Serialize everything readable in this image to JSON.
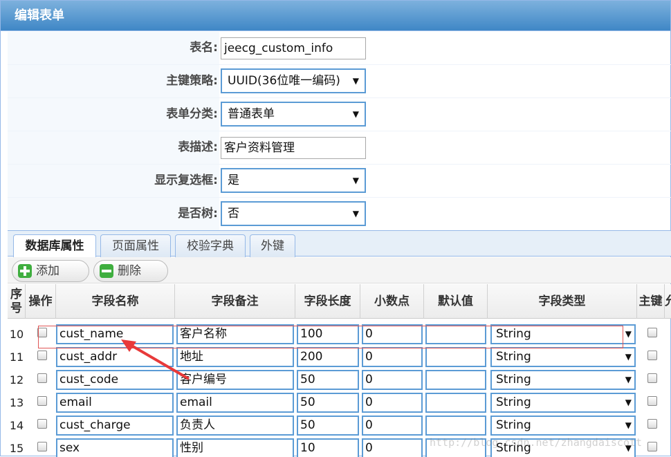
{
  "panel": {
    "title": "编辑表单"
  },
  "form": {
    "table_name": {
      "label": "表名:",
      "value": "jeecg_custom_info"
    },
    "pk_strategy": {
      "label": "主键策略:",
      "value": "UUID(36位唯一编码)"
    },
    "form_category": {
      "label": "表单分类:",
      "value": "普通表单"
    },
    "table_desc": {
      "label": "表描述:",
      "value": "客户资料管理"
    },
    "show_checkbox": {
      "label": "显示复选框:",
      "value": "是"
    },
    "is_tree": {
      "label": "是否树:",
      "value": "否"
    }
  },
  "tabs": [
    "数据库属性",
    "页面属性",
    "校验字典",
    "外键"
  ],
  "toolbar": {
    "add_label": "添加",
    "delete_label": "删除"
  },
  "grid": {
    "headers": {
      "seq": "序号",
      "op": "操作",
      "field_name": "字段名称",
      "field_comment": "字段备注",
      "field_length": "字段长度",
      "decimal": "小数点",
      "default": "默认值",
      "field_type": "字段类型",
      "pk": "主键",
      "extra": "允"
    },
    "rows": [
      {
        "seq": "10",
        "name": "cust_name",
        "comment": "客户名称",
        "length": "100",
        "decimal": "0",
        "default": "",
        "type": "String"
      },
      {
        "seq": "11",
        "name": "cust_addr",
        "comment": "地址",
        "length": "200",
        "decimal": "0",
        "default": "",
        "type": "String"
      },
      {
        "seq": "12",
        "name": "cust_code",
        "comment": "客户编号",
        "length": "50",
        "decimal": "0",
        "default": "",
        "type": "String"
      },
      {
        "seq": "13",
        "name": "email",
        "comment": "email",
        "length": "50",
        "decimal": "0",
        "default": "",
        "type": "String"
      },
      {
        "seq": "14",
        "name": "cust_charge",
        "comment": "负责人",
        "length": "50",
        "decimal": "0",
        "default": "",
        "type": "String"
      },
      {
        "seq": "15",
        "name": "sex",
        "comment": "性别",
        "length": "10",
        "decimal": "0",
        "default": "",
        "type": "String"
      }
    ]
  },
  "watermark": "http://blog.csdn.net/zhangdaiscott",
  "colors": {
    "header": "#3f87c6",
    "input_border": "#5b9bd5",
    "highlight": "#e05555"
  }
}
